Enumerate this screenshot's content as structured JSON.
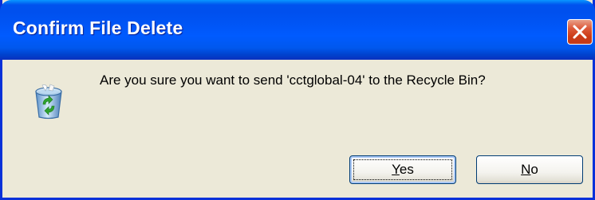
{
  "window": {
    "title": "Confirm File Delete"
  },
  "dialog": {
    "message": "Are you sure you want to send 'cctglobal-04' to the Recycle Bin?",
    "icon": "recycle-bin-icon"
  },
  "buttons": {
    "yes_mnemonic": "Y",
    "yes_rest": "es",
    "no_mnemonic": "N",
    "no_rest": "o"
  },
  "colors": {
    "titlebar": "#0055f5",
    "dialog_background": "#ece9d8",
    "close_button": "#dd5a3a"
  }
}
